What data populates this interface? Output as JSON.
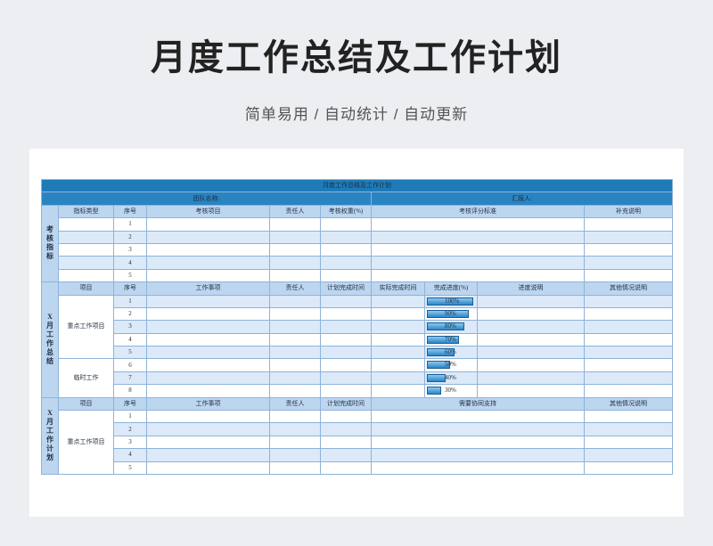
{
  "hero": {
    "title": "月度工作总结及工作计划",
    "subtitle": "简单易用  /  自动统计  /  自动更新"
  },
  "sheet": {
    "title": "月度工作总结及工作计划",
    "team_label": "团队名称:",
    "reporter_label": "汇报人:",
    "section1": {
      "side_label": "考核指标",
      "headers": [
        "指标类型",
        "序号",
        "考核项目",
        "责任人",
        "考核权重(%)",
        "考核评分标准",
        "补充说明"
      ],
      "rows": [
        "1",
        "2",
        "3",
        "4",
        "5"
      ]
    },
    "section2": {
      "side_label": "X月工作总结",
      "headers": [
        "项目",
        "序号",
        "工作事项",
        "责任人",
        "计划完成时间",
        "实际完成时间",
        "完成进度(%)",
        "进度说明",
        "其他情况说明"
      ],
      "groups": [
        {
          "name": "重点工作项目",
          "rows": [
            {
              "no": "1",
              "progress": "100%",
              "value": 100
            },
            {
              "no": "2",
              "progress": "90%",
              "value": 90
            },
            {
              "no": "3",
              "progress": "80%",
              "value": 80
            },
            {
              "no": "4",
              "progress": "70%",
              "value": 70
            },
            {
              "no": "5",
              "progress": "60%",
              "value": 60
            }
          ]
        },
        {
          "name": "临时工作",
          "rows": [
            {
              "no": "6",
              "progress": "50%",
              "value": 50
            },
            {
              "no": "7",
              "progress": "40%",
              "value": 40
            },
            {
              "no": "8",
              "progress": "30%",
              "value": 30
            }
          ]
        }
      ]
    },
    "section3": {
      "side_label": "X月工作计划",
      "headers": [
        "项目",
        "序号",
        "工作事项",
        "责任人",
        "计划完成时间",
        "需要协同支持",
        "其他情况说明"
      ],
      "group_name": "重点工作项目",
      "rows": [
        "1",
        "2",
        "3",
        "4",
        "5"
      ]
    }
  }
}
